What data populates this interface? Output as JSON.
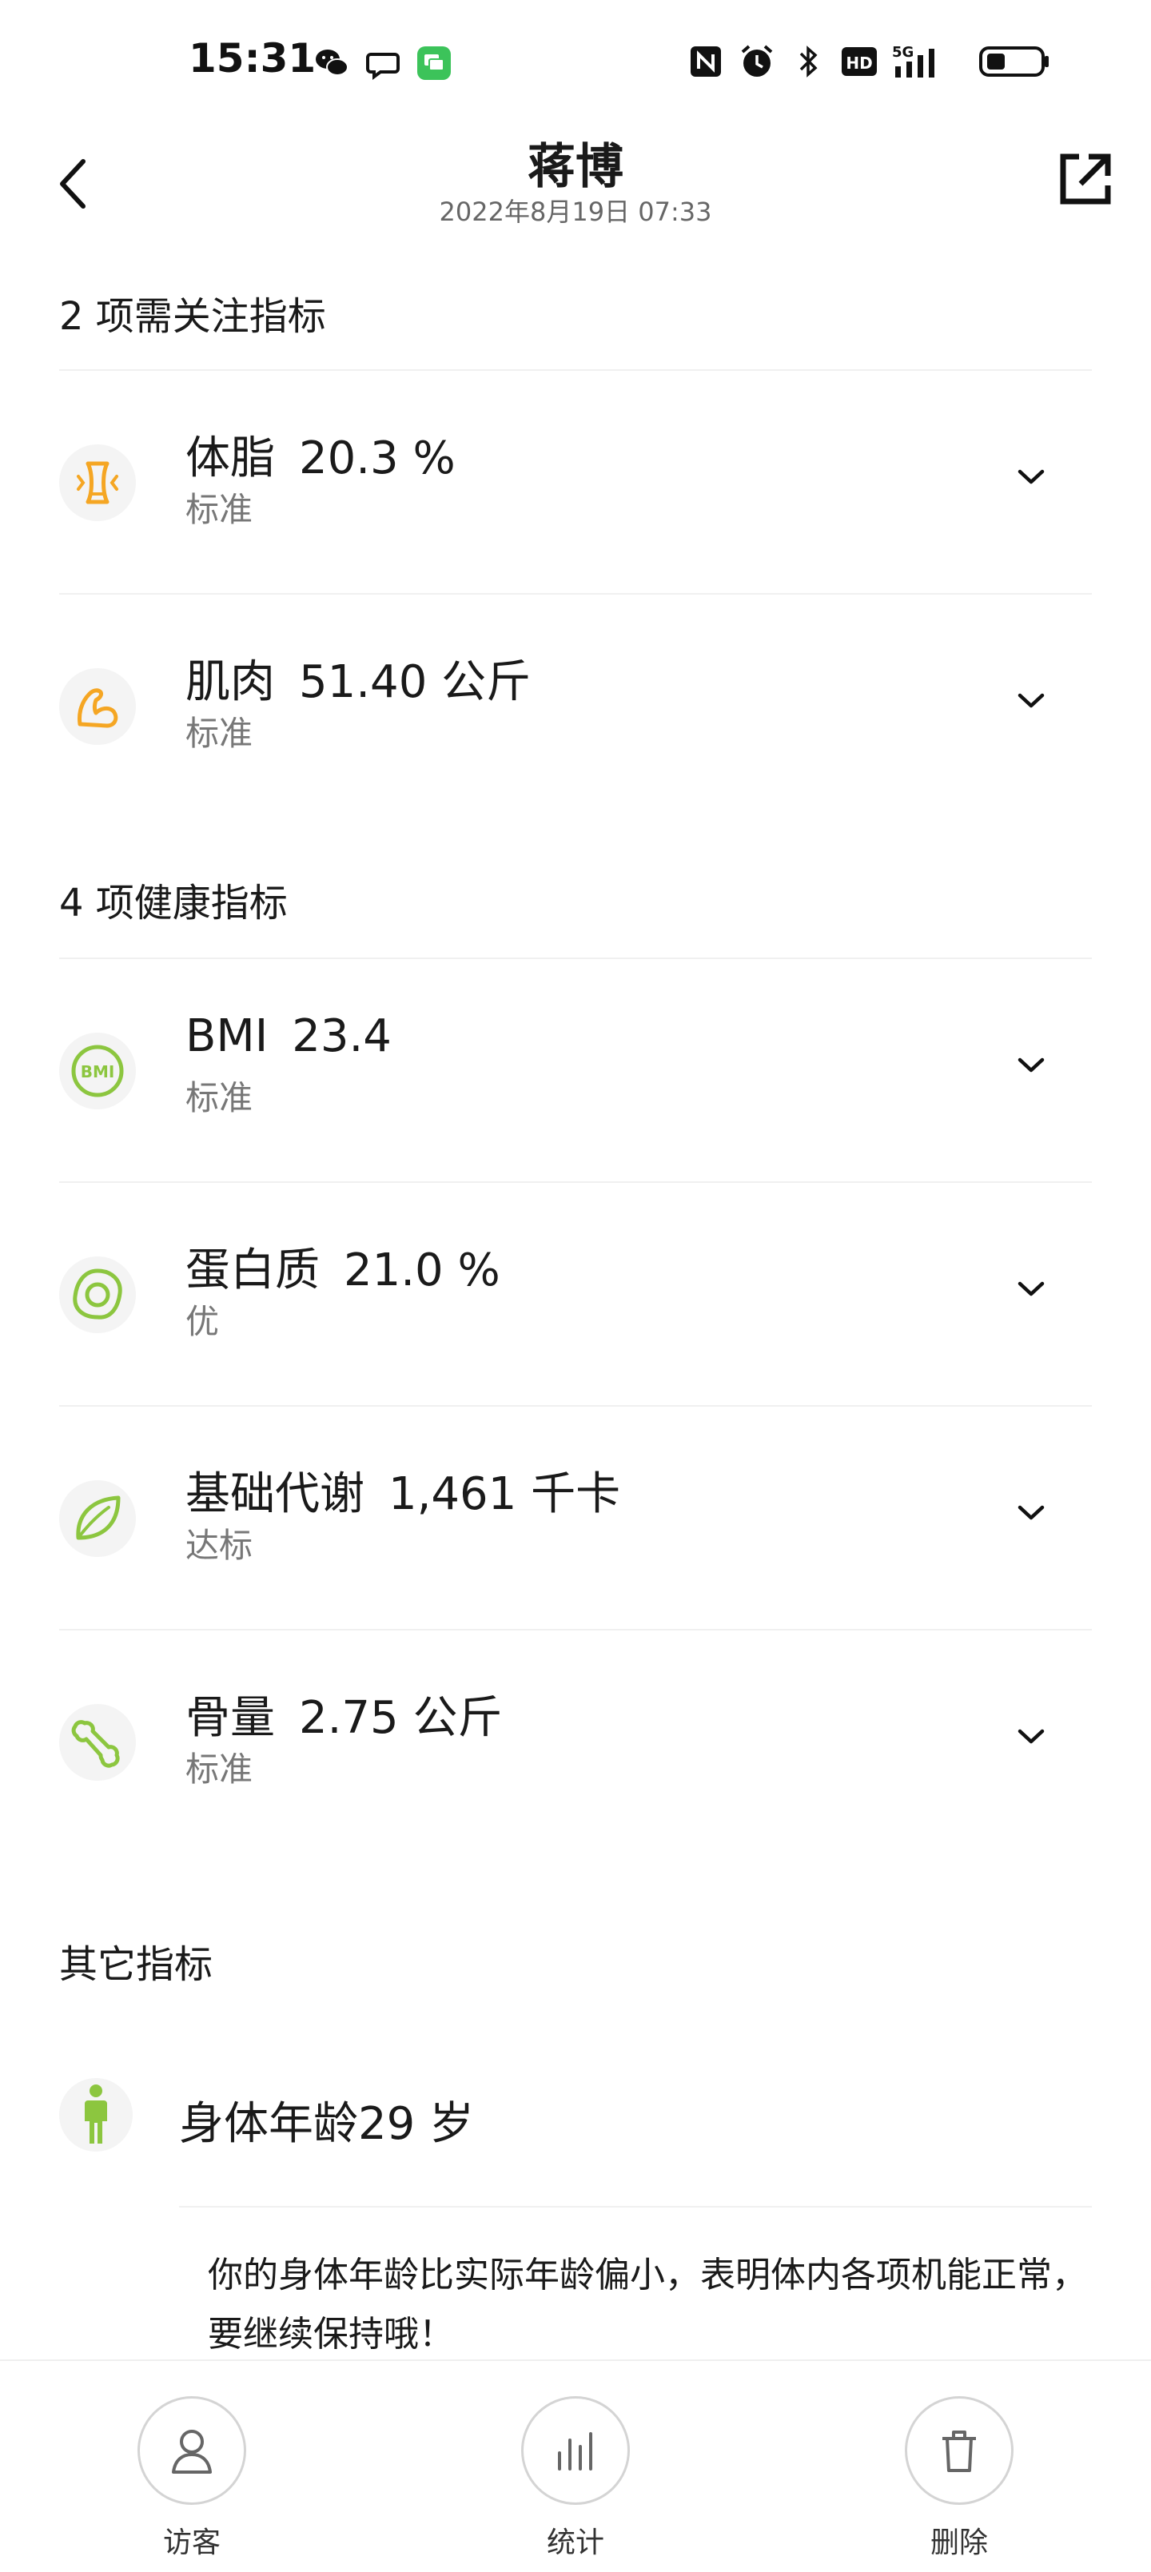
{
  "status_bar": {
    "time": "15:31",
    "left_icons": [
      "wechat-icon",
      "message-bubble-icon",
      "green-chat-app-icon"
    ],
    "right_icons": [
      "nfc-icon",
      "alarm-icon",
      "bluetooth-icon",
      "hd-icon",
      "signal-5g-icon",
      "battery-icon"
    ],
    "hd_label": "HD",
    "network_label": "5G"
  },
  "header": {
    "title": "蒋博",
    "subtitle": "2022年8月19日 07:33"
  },
  "sections": {
    "attention_title": "2 项需关注指标",
    "healthy_title": "4 项健康指标",
    "other_title": "其它指标"
  },
  "attention_items": [
    {
      "name": "体脂",
      "value": "20.3 %",
      "status": "标准",
      "icon": "waist-icon"
    },
    {
      "name": "肌肉",
      "value": "51.40 公斤",
      "status": "标准",
      "icon": "flexed-arm-icon"
    }
  ],
  "healthy_items": [
    {
      "name": "BMI",
      "value": "23.4",
      "status": "标准",
      "icon": "bmi-icon",
      "icon_text": "BMI"
    },
    {
      "name": "蛋白质",
      "value": "21.0 %",
      "status": "优",
      "icon": "egg-icon"
    },
    {
      "name": "基础代谢",
      "value": "1,461 千卡",
      "status": "达标",
      "icon": "leaf-icon"
    },
    {
      "name": "骨量",
      "value": "2.75 公斤",
      "status": "标准",
      "icon": "bone-icon"
    }
  ],
  "other": {
    "body_age_label": "身体年龄29 岁",
    "description": "你的身体年龄比实际年龄偏小，表明体内各项机能正常，要继续保持哦！"
  },
  "bottom_bar": {
    "visitor_label": "访客",
    "stats_label": "统计",
    "delete_label": "删除"
  },
  "colors": {
    "attention_accent": "#f5a623",
    "healthy_accent": "#8cc63f",
    "text_primary": "#1a1a1a",
    "text_secondary": "#777777"
  }
}
